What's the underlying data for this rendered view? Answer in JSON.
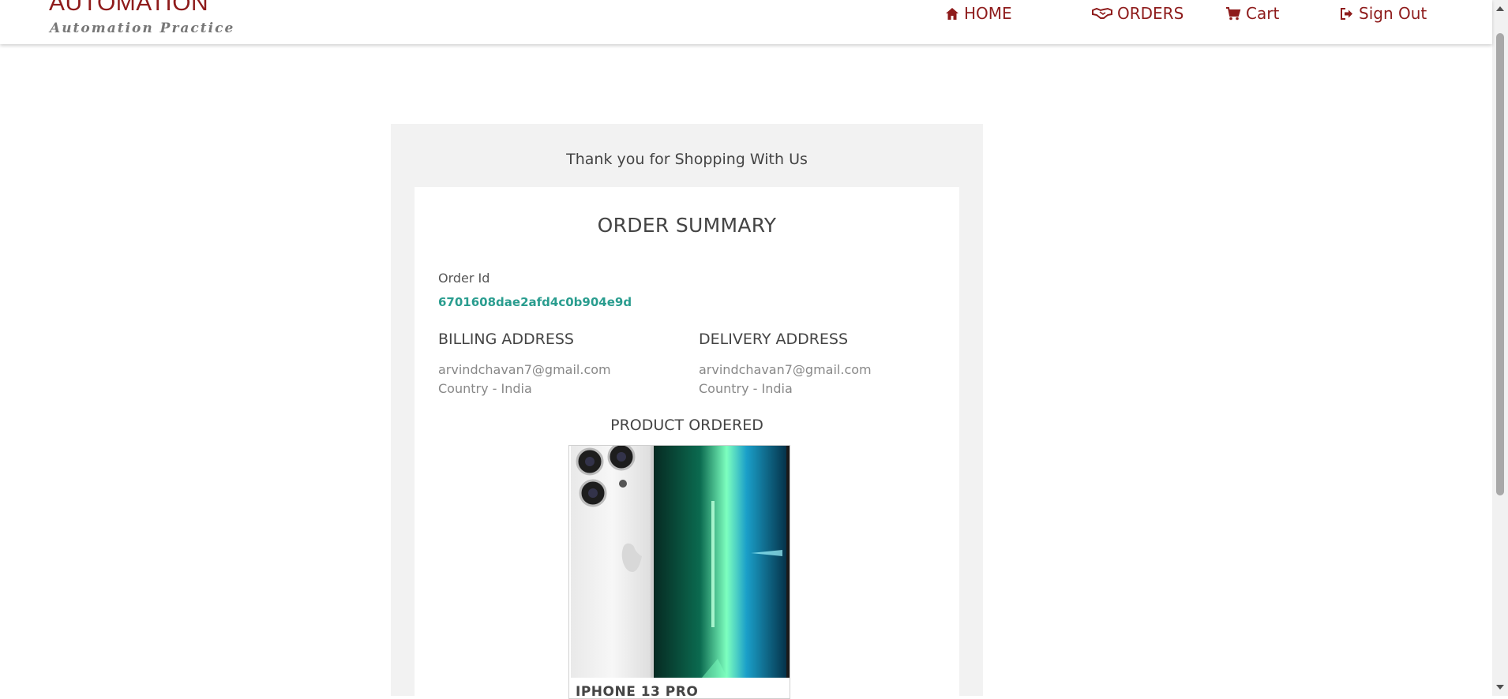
{
  "header": {
    "brand": "AUTOMATION",
    "tagline": "Automation Practice",
    "nav": {
      "home": "HOME",
      "orders": "ORDERS",
      "cart": "Cart",
      "signout": "Sign Out"
    },
    "icons": {
      "home": "home-icon",
      "orders": "handshake-icon",
      "cart": "cart-icon",
      "signout": "sign-out-icon"
    }
  },
  "page": {
    "thank_you": "Thank you for Shopping With Us",
    "summary_title": "ORDER SUMMARY",
    "order_id_label": "Order Id",
    "order_id": "6701608dae2afd4c0b904e9d",
    "billing": {
      "title": "BILLING ADDRESS",
      "email": "arvindchavan7@gmail.com",
      "country": "Country - India"
    },
    "delivery": {
      "title": "DELIVERY ADDRESS",
      "email": "arvindchavan7@gmail.com",
      "country": "Country - India"
    },
    "product_heading": "PRODUCT ORDERED",
    "product_name": "IPHONE 13 PRO"
  },
  "colors": {
    "brand": "#8e1b1b",
    "order_id": "#2a9d8f",
    "panel": "#f2f2f2"
  }
}
